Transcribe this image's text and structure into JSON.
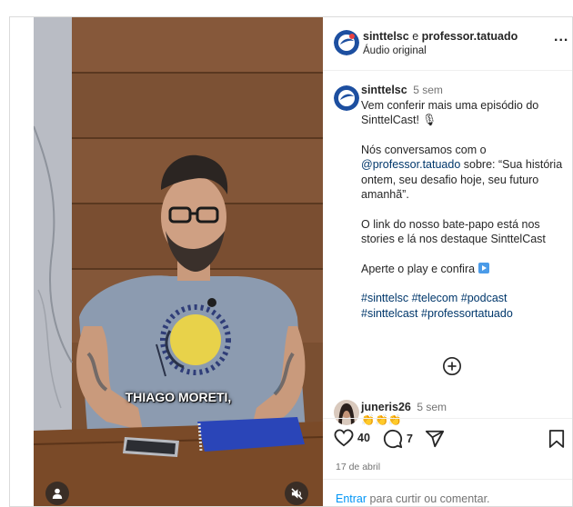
{
  "video": {
    "subtitle": "THIAGO MORETI,",
    "shirt_text": "um girassol",
    "user_icon": "person-icon",
    "mute_icon": "muted-speaker-icon"
  },
  "header": {
    "user1": "sinttelsc",
    "connector": "e",
    "user2": "professor.tatuado",
    "audio": "Áudio original",
    "more": "..."
  },
  "caption": {
    "username": "sinttelsc",
    "time": "5 sem",
    "line1": "Vem conferir mais uma episódio do SinttelCast! 🎙",
    "line2_prefix": "Nós conversamos com o ",
    "mention": "@professor.tatuado",
    "line2_suffix": " sobre: “Sua história ontem, seu desafio hoje, seu futuro amanhã”.",
    "line3": "O link do nosso bate-papo está nos stories e lá nos destaque SinttelCast",
    "line4": "Aperte o play e confira",
    "hashtags_1": "#sinttelsc #telecom #podcast",
    "hashtags_2": "#sinttelcast #professortatuado"
  },
  "comment": {
    "username": "juneris26",
    "time": "5 sem",
    "text": "👏👏👏"
  },
  "actions": {
    "likes": "40",
    "comments": "7",
    "date": "17 de abril"
  },
  "footer": {
    "login": "Entrar",
    "rest": " para curtir ou comentar."
  },
  "colors": {
    "link": "#00376b",
    "login_blue": "#0095f6",
    "muted": "#737373",
    "border": "#dbdbdb"
  }
}
